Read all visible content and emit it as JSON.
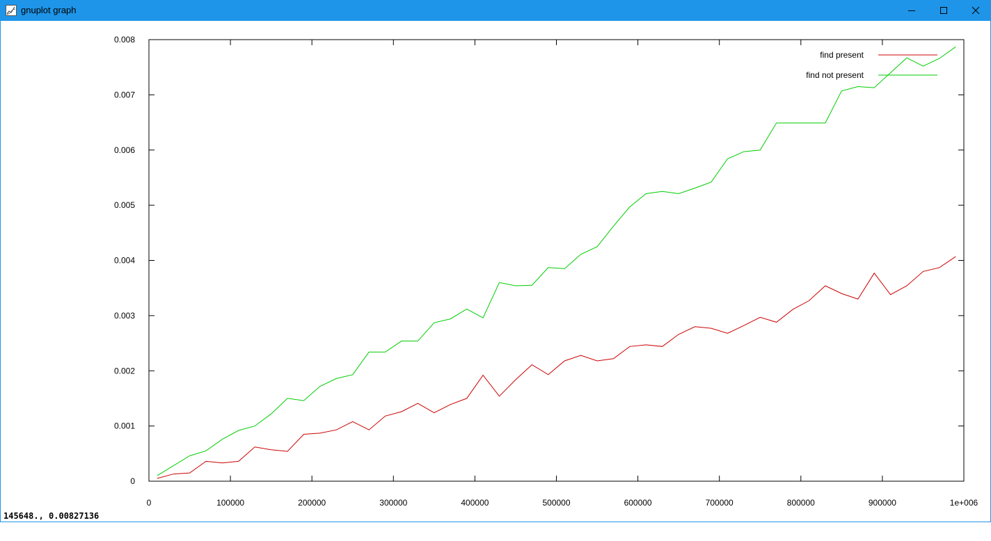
{
  "window": {
    "title": "gnuplot graph",
    "accent_color": "#1e95e8",
    "icon": "gnuplot-app-icon",
    "controls": [
      "minimize-icon",
      "maximize-icon",
      "close-icon"
    ]
  },
  "status": {
    "coordinates": "145648., 0.00827136"
  },
  "chart_data": {
    "type": "line",
    "title": "",
    "xlabel": "",
    "ylabel": "",
    "xlim": [
      0,
      1000000
    ],
    "ylim": [
      0,
      0.008
    ],
    "xticks": [
      "0",
      "100000",
      "200000",
      "300000",
      "400000",
      "500000",
      "600000",
      "700000",
      "800000",
      "900000",
      "1e+006"
    ],
    "yticks": [
      "0",
      "0.001",
      "0.002",
      "0.003",
      "0.004",
      "0.005",
      "0.006",
      "0.007",
      "0.008"
    ],
    "grid": false,
    "legend_position": "top-right",
    "x": [
      10000,
      30000,
      50000,
      70000,
      90000,
      110000,
      130000,
      150000,
      170000,
      190000,
      210000,
      230000,
      250000,
      270000,
      290000,
      310000,
      330000,
      350000,
      370000,
      390000,
      410000,
      430000,
      450000,
      470000,
      490000,
      510000,
      530000,
      550000,
      570000,
      590000,
      610000,
      630000,
      650000,
      670000,
      690000,
      710000,
      730000,
      750000,
      770000,
      790000,
      810000,
      830000,
      850000,
      870000,
      890000,
      910000,
      930000,
      950000,
      970000,
      990000
    ],
    "series": [
      {
        "name": "find present",
        "color": "#cc0000",
        "values": [
          5e-05,
          0.00013,
          0.00015,
          0.00036,
          0.00033,
          0.00036,
          0.00062,
          0.00057,
          0.00054,
          0.00085,
          0.00087,
          0.00093,
          0.00108,
          0.00093,
          0.00118,
          0.00126,
          0.00141,
          0.00124,
          0.00139,
          0.0015,
          0.00192,
          0.00154,
          0.00184,
          0.00211,
          0.00193,
          0.00218,
          0.00228,
          0.00218,
          0.00222,
          0.00244,
          0.00247,
          0.00244,
          0.00266,
          0.0028,
          0.00277,
          0.00268,
          0.00282,
          0.00297,
          0.00288,
          0.00311,
          0.00327,
          0.00354,
          0.0034,
          0.0033,
          0.00377,
          0.00338,
          0.00354,
          0.0038,
          0.00387,
          0.00407
        ]
      },
      {
        "name": "find not present",
        "color": "#00cc00",
        "values": [
          0.0001,
          0.00028,
          0.00046,
          0.00055,
          0.00076,
          0.00092,
          0.001,
          0.00122,
          0.0015,
          0.00146,
          0.00172,
          0.00186,
          0.00193,
          0.00234,
          0.00234,
          0.00254,
          0.00254,
          0.00287,
          0.00294,
          0.00312,
          0.00296,
          0.0036,
          0.00354,
          0.00355,
          0.00387,
          0.00385,
          0.00411,
          0.00425,
          0.00462,
          0.00497,
          0.00521,
          0.00525,
          0.00521,
          0.00531,
          0.00542,
          0.00584,
          0.00597,
          0.006,
          0.00649,
          0.00649,
          0.00649,
          0.00649,
          0.00707,
          0.00715,
          0.00713,
          0.0074,
          0.00767,
          0.00752,
          0.00766,
          0.00787
        ]
      }
    ]
  }
}
